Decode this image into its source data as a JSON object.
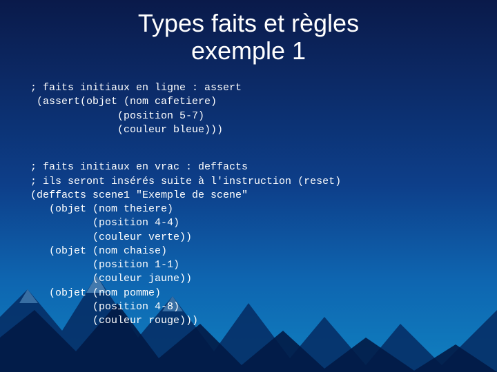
{
  "title_line1": "Types faits et règles",
  "title_line2": "exemple 1",
  "code": {
    "l01": "; faits initiaux en ligne : assert",
    "l02": " (assert(objet (nom cafetiere)",
    "l03": "              (position 5-7)",
    "l04": "              (couleur bleue)))",
    "l05": "; faits initiaux en vrac : deffacts",
    "l06": "; ils seront insérés suite à l'instruction (reset)",
    "l07": "(deffacts scene1 \"Exemple de scene\"",
    "l08": "   (objet (nom theiere)",
    "l09": "          (position 4-4)",
    "l10": "          (couleur verte))",
    "l11": "   (objet (nom chaise)",
    "l12": "          (position 1-1)",
    "l13": "          (couleur jaune))",
    "l14": "   (objet (nom pomme)",
    "l15": "          (position 4-8)",
    "l16": "          (couleur rouge)))"
  }
}
